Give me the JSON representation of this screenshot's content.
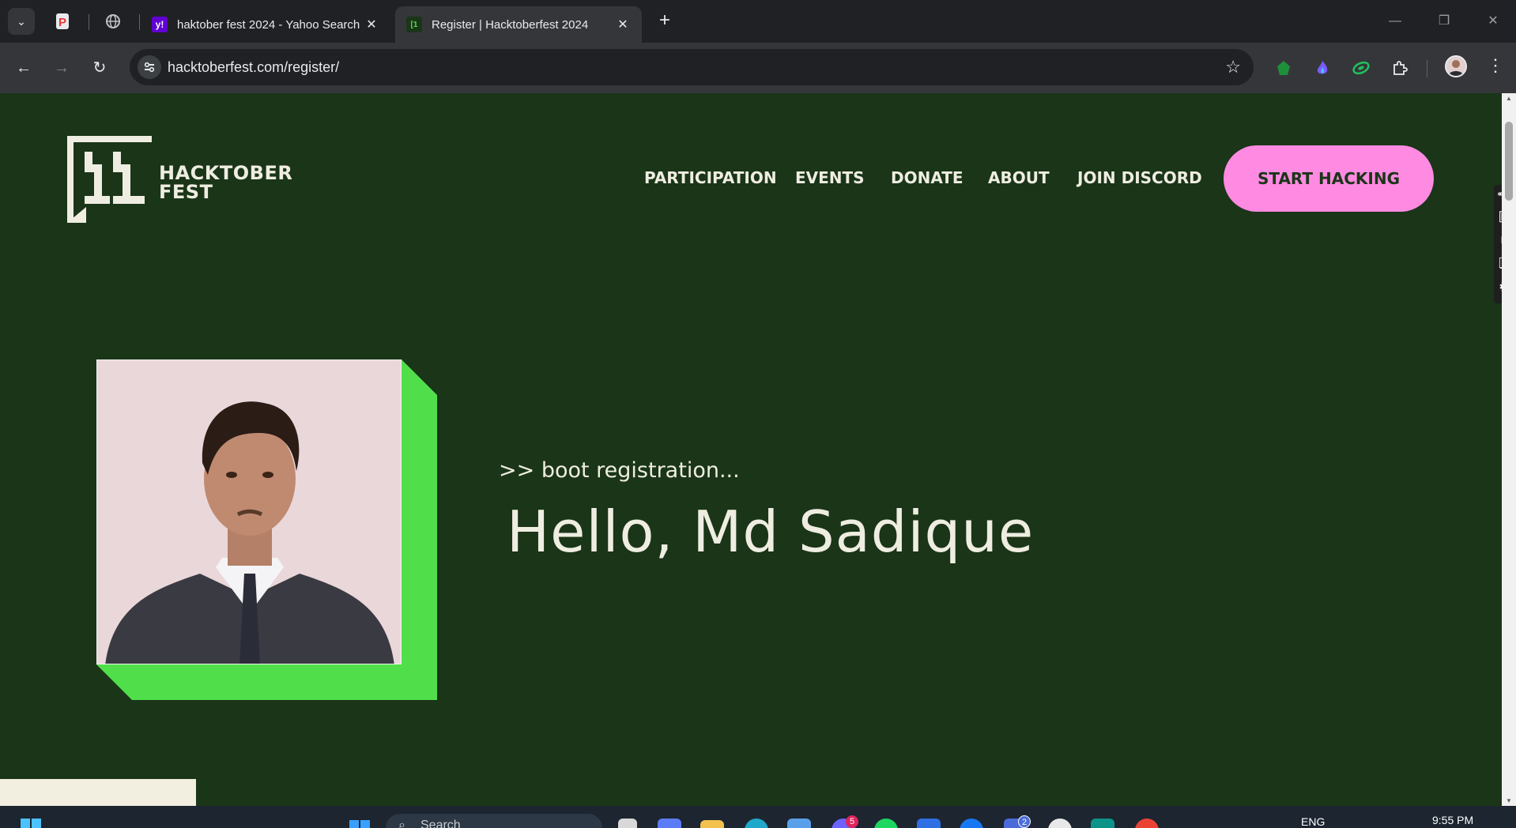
{
  "browser": {
    "tabs": [
      {
        "title": "haktober fest 2024 - Yahoo Search",
        "favicon": "yahoo-icon",
        "active": false
      },
      {
        "title": "Register | Hacktoberfest 2024",
        "favicon": "hacktoberfest-icon",
        "active": true
      }
    ],
    "new_tab_label": "+",
    "url": "hacktoberfest.com/register/"
  },
  "site": {
    "logo_line1": "HACKTOBER",
    "logo_line2": "FEST",
    "nav": [
      "PARTICIPATION",
      "EVENTS",
      "DONATE",
      "ABOUT",
      "JOIN DISCORD"
    ],
    "cta_label": "START HACKING"
  },
  "hero": {
    "boot_text": ">> boot registration...",
    "greeting": "Hello, Md Sadique"
  },
  "taskbar": {
    "search_placeholder": "Search",
    "language": "ENG",
    "time": "9:55 PM",
    "badges": {
      "messenger": "5",
      "teams": "2"
    }
  },
  "colors": {
    "page_bg": "#1a3518",
    "cream": "#efede1",
    "accent_pink": "#ff8ae2",
    "accent_green": "#50df4a"
  }
}
